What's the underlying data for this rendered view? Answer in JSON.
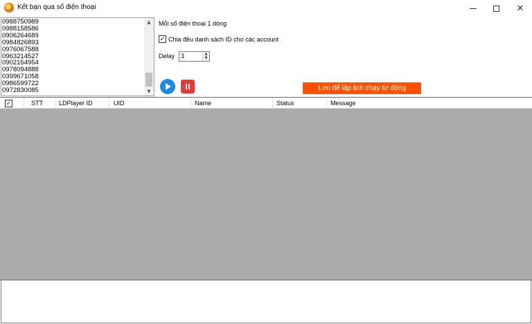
{
  "window": {
    "title": "Kết bạn qua số điện thoại",
    "close_glyph": "✕"
  },
  "phone_list": {
    "lines": [
      "0988750989",
      "0988158586",
      "0906264689",
      "0984826893",
      "0976067588",
      "0963214527",
      "0902154954",
      "0978094888",
      "0399671058",
      "0986599722",
      "0972830085"
    ],
    "scroll_up_glyph": "▲",
    "scroll_down_glyph": "▼"
  },
  "options": {
    "note": "Mỗi số điện thoại 1 dòng",
    "split_ids_label": "Chia đều danh sách ID cho các account",
    "split_ids_checked": true,
    "check_glyph": "✓",
    "delay_label": "Delay",
    "delay_value": "3",
    "spin_up_glyph": "▲",
    "spin_down_glyph": "▼"
  },
  "actions": {
    "play_icon": "play-icon",
    "stop_icon": "pause-icon",
    "save_schedule_label": "Lưu để lập lịch chạy tự động",
    "save_color": "#ff5100"
  },
  "grid": {
    "columns": [
      "STT",
      "LDPlayer ID",
      "UID",
      "Name",
      "Status",
      "Message"
    ],
    "header_check_glyph": "✓",
    "rows": []
  },
  "colors": {
    "grid_background": "#ababab",
    "play": "#1e88e5",
    "stop": "#e53935"
  }
}
